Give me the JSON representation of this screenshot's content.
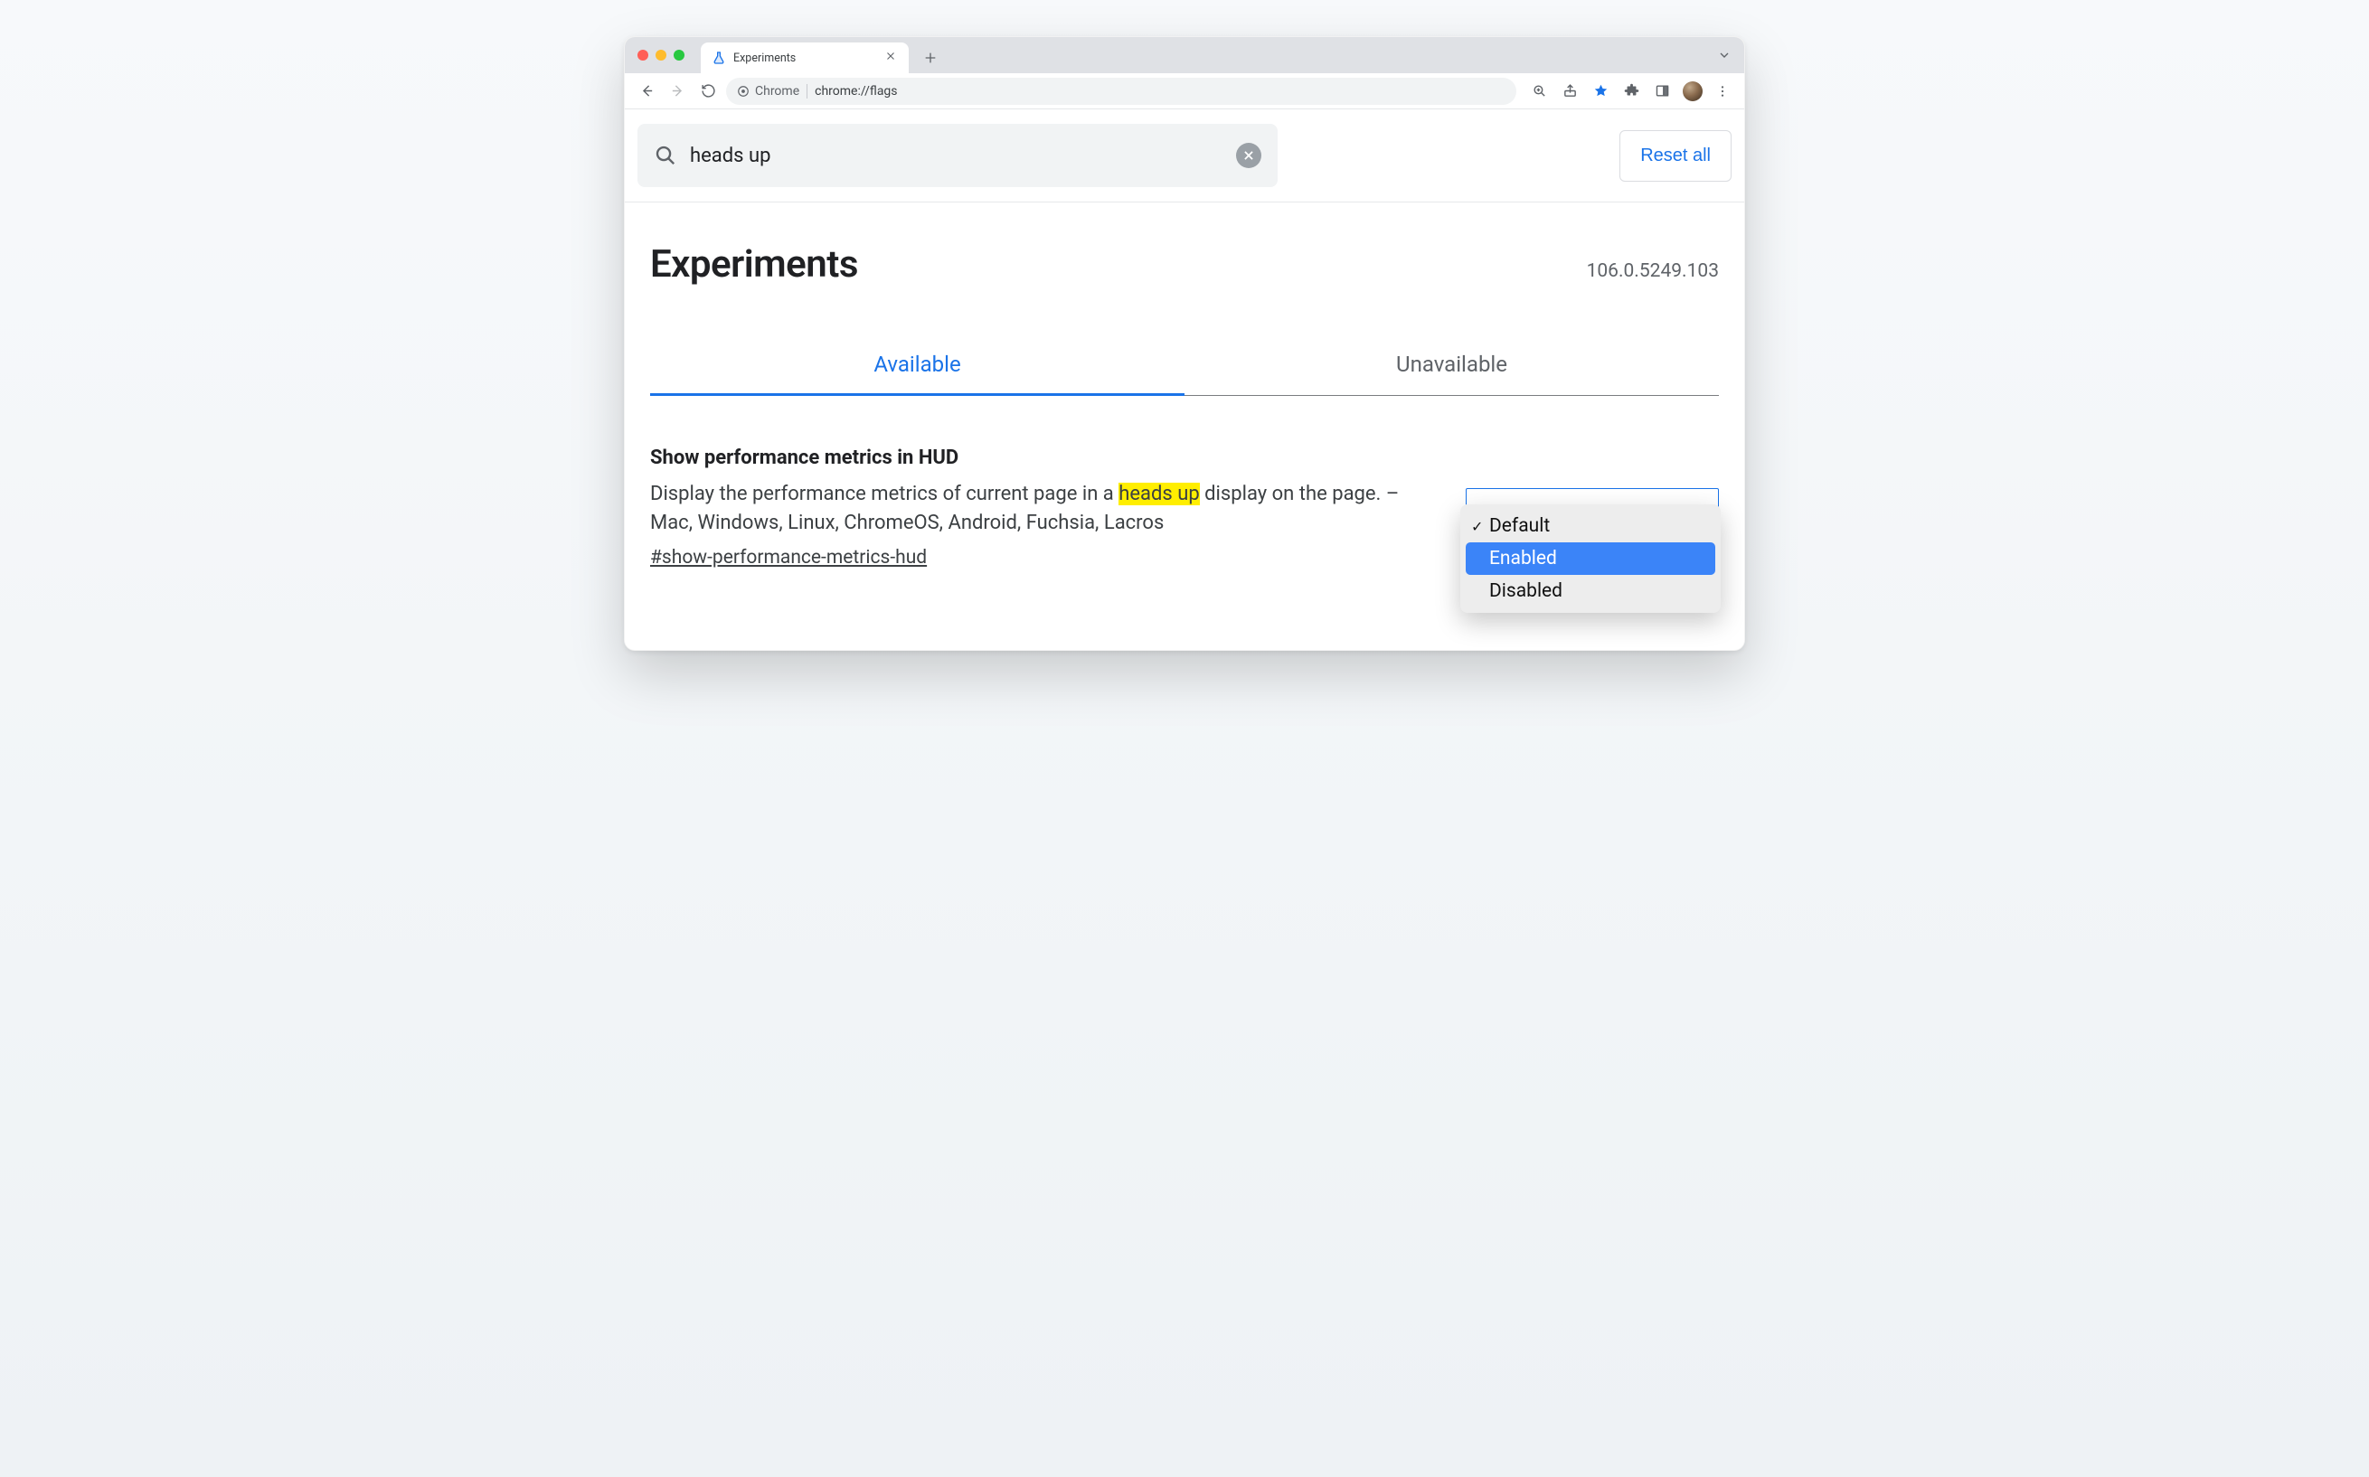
{
  "browser": {
    "tab": {
      "title": "Experiments"
    },
    "omnibox": {
      "chip": "Chrome",
      "url": "chrome://flags"
    }
  },
  "search": {
    "value": "heads up",
    "reset_label": "Reset all"
  },
  "header": {
    "title": "Experiments",
    "version": "106.0.5249.103"
  },
  "tabs": {
    "available": "Available",
    "unavailable": "Unavailable"
  },
  "flag": {
    "title": "Show performance metrics in HUD",
    "desc_before": "Display the performance metrics of current page in a ",
    "desc_highlight": "heads up",
    "desc_after": " display on the page. – Mac, Windows, Linux, ChromeOS, Android, Fuchsia, Lacros",
    "hash": "#show-performance-metrics-hud",
    "select": {
      "options": [
        "Default",
        "Enabled",
        "Disabled"
      ],
      "checked": "Default",
      "highlighted": "Enabled"
    }
  }
}
